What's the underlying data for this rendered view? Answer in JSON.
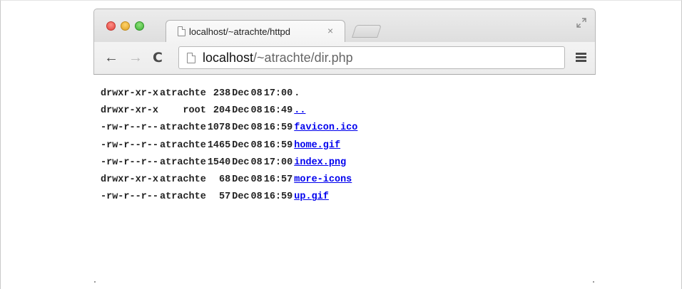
{
  "browser": {
    "tab": {
      "title": "localhost/~atrachte/httpd",
      "close_glyph": "×"
    },
    "toolbar": {
      "back_glyph": "←",
      "forward_glyph": "→",
      "reload_glyph": "C",
      "url_host": "localhost",
      "url_path": "/~atrachte/dir.php"
    }
  },
  "listing": [
    {
      "perms": "drwxr-xr-x",
      "owner": "atrachte",
      "size": "238",
      "month": "Dec",
      "day": "08",
      "time": "17:00",
      "name": ".",
      "is_link": false
    },
    {
      "perms": "drwxr-xr-x",
      "owner": "root",
      "size": "204",
      "month": "Dec",
      "day": "08",
      "time": "16:49",
      "name": "..",
      "is_link": true
    },
    {
      "perms": "-rw-r--r--",
      "owner": "atrachte",
      "size": "1078",
      "month": "Dec",
      "day": "08",
      "time": "16:59",
      "name": "favicon.ico",
      "is_link": true
    },
    {
      "perms": "-rw-r--r--",
      "owner": "atrachte",
      "size": "1465",
      "month": "Dec",
      "day": "08",
      "time": "16:59",
      "name": "home.gif",
      "is_link": true
    },
    {
      "perms": "-rw-r--r--",
      "owner": "atrachte",
      "size": "1540",
      "month": "Dec",
      "day": "08",
      "time": "17:00",
      "name": "index.png",
      "is_link": true
    },
    {
      "perms": "drwxr-xr-x",
      "owner": "atrachte",
      "size": "68",
      "month": "Dec",
      "day": "08",
      "time": "16:57",
      "name": "more-icons",
      "is_link": true
    },
    {
      "perms": "-rw-r--r--",
      "owner": "atrachte",
      "size": "57",
      "month": "Dec",
      "day": "08",
      "time": "16:59",
      "name": "up.gif",
      "is_link": true
    }
  ],
  "colors": {
    "link": "#0000ee",
    "text": "#222222",
    "close_red": "#e0443e",
    "minimize_yellow": "#dea123",
    "zoom_green": "#3fb237"
  },
  "icons": {
    "close_window": "close-window-icon",
    "minimize_window": "minimize-window-icon",
    "zoom_window": "zoom-window-icon",
    "favicon": "page-icon",
    "fullscreen": "fullscreen-icon",
    "menu": "hamburger-menu-icon"
  }
}
